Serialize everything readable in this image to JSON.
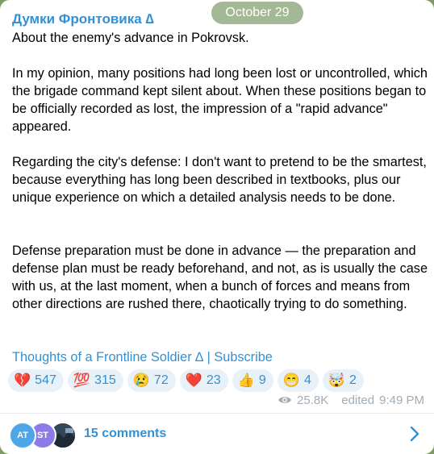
{
  "date_pill": "October 29",
  "post": {
    "channel_name": "Думки Фронтовика ∆",
    "paragraphs": [
      "About the enemy's advance in Pokrovsk.",
      "In my opinion, many positions had long been lost or uncontrolled, which the brigade command kept silent about. When these positions began to be officially recorded as lost, the impression of a \"rapid advance\" appeared.",
      "Regarding the city's defense: I don't want to pretend to be the smartest, because everything has long been described in textbooks, plus our unique experience on which a detailed analysis needs to be done.",
      "Defense preparation must be done in advance — the preparation and defense plan must be ready beforehand, and not, as is usually the case with us, at the last moment, when a bunch of forces and means from other directions are rushed there, chaotically trying to do something."
    ],
    "signature": {
      "channel_link": "Thoughts of a Frontline Soldier ∆",
      "separator": "|",
      "subscribe_link": "Subscribe"
    },
    "reactions": [
      {
        "emoji": "💔",
        "count": "547",
        "icon": "broken-heart"
      },
      {
        "emoji": "💯",
        "count": "315",
        "icon": "hundred"
      },
      {
        "emoji": "😢",
        "count": "72",
        "icon": "crying-face"
      },
      {
        "emoji": "❤️",
        "count": "23",
        "icon": "red-heart"
      },
      {
        "emoji": "👍",
        "count": "9",
        "icon": "thumbs-up"
      },
      {
        "emoji": "😁",
        "count": "4",
        "icon": "grinning-face"
      },
      {
        "emoji": "🤯",
        "count": "2",
        "icon": "exploding-head"
      }
    ],
    "views": "25.8K",
    "edited": "edited",
    "time": "9:49 PM"
  },
  "comments": {
    "avatars": [
      "AT",
      "ST",
      ""
    ],
    "label": "15 comments"
  },
  "colors": {
    "accent": "#3390d2",
    "chat_background": "#7f9a68",
    "reaction_background": "#e9f1f8",
    "meta_text": "#a0acb6"
  }
}
